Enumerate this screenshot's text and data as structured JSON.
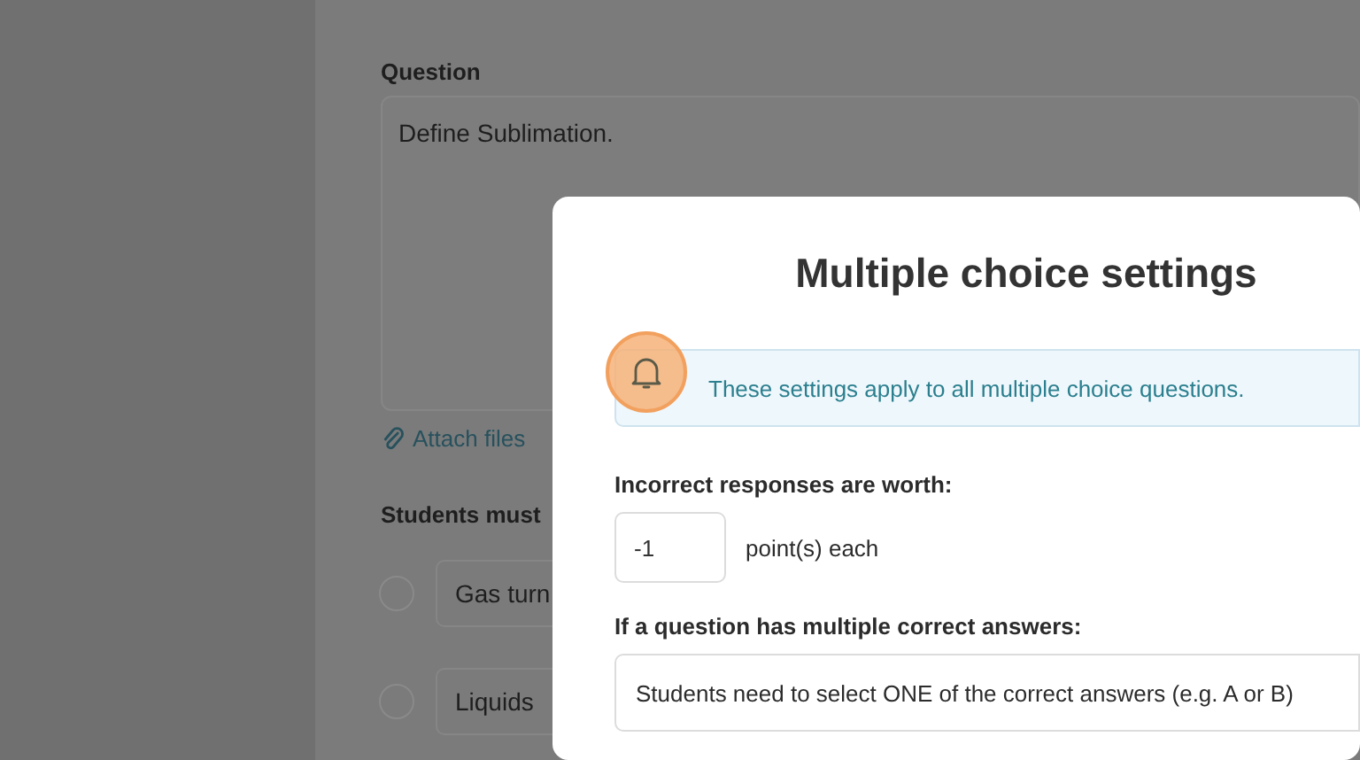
{
  "background": {
    "question_label": "Question",
    "question_text": "Define Sublimation.",
    "attach_link": "Attach files",
    "students_label": "Students must",
    "options": [
      {
        "text": "Gas turn",
        "selected": false
      },
      {
        "text": "Liquids",
        "selected": false
      }
    ]
  },
  "modal": {
    "title": "Multiple choice settings",
    "notice": "These settings apply to all multiple choice questions.",
    "incorrect_label": "Incorrect responses are worth:",
    "incorrect_value": "-1",
    "incorrect_unit": "point(s) each",
    "multiple_label": "If a question has multiple correct answers:",
    "multiple_value": "Students need to select ONE of the correct answers (e.g. A or B)"
  }
}
